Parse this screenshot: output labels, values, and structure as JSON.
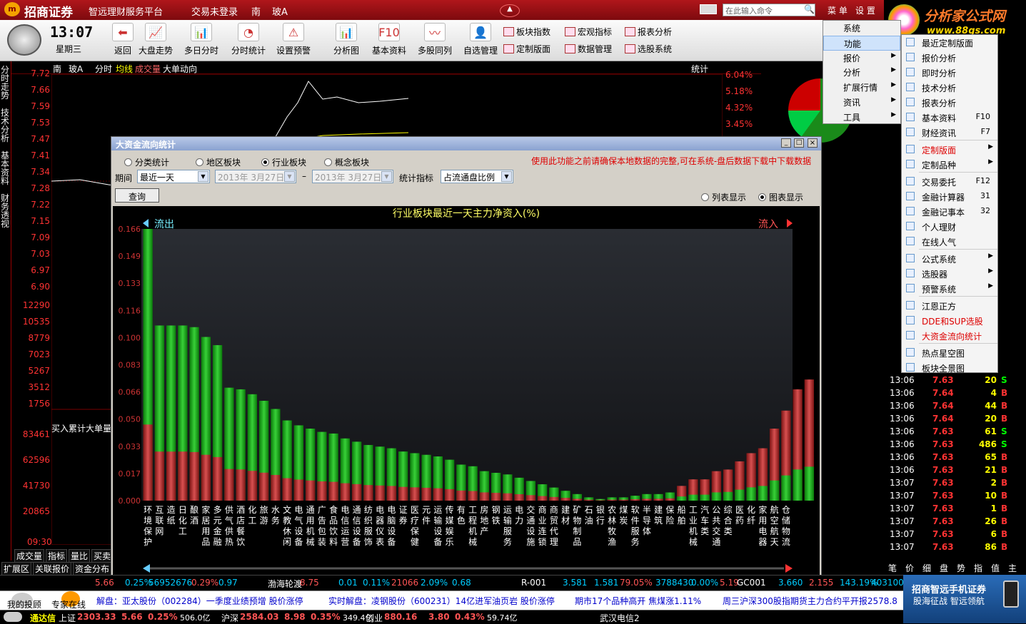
{
  "titlebar": {
    "brand": "招商证券",
    "platform": "智远理财服务平台",
    "status": "交易未登录",
    "region": "南",
    "stock": "玻A",
    "menu_btn": "菜 单",
    "settings_btn": "设 置",
    "search_placeholder": "在此输入命令"
  },
  "logo_right": {
    "name": "分析家公式网",
    "url": "www.88gs.com"
  },
  "clock": {
    "time": "13:07",
    "weekday": "星期三"
  },
  "toolbar": [
    {
      "label": "返回",
      "icon": "back-arrow-icon"
    },
    {
      "label": "大盘走势",
      "icon": "market-trend-icon"
    },
    {
      "label": "多日分时",
      "icon": "multi-day-icon"
    },
    {
      "label": "分时统计",
      "icon": "pie-stat-icon"
    },
    {
      "label": "设置预警",
      "icon": "warning-icon"
    },
    {
      "label": "分析图",
      "icon": "candlestick-icon"
    },
    {
      "label": "基本资料",
      "icon": "f10-icon"
    },
    {
      "label": "多股同列",
      "icon": "multi-stock-icon"
    },
    {
      "label": "自选管理",
      "icon": "watchlist-icon"
    }
  ],
  "toolbar_small": [
    "板块指数",
    "宏观指标",
    "报表分析",
    "定制版面",
    "数据管理",
    "选股系统"
  ],
  "left_tabs": [
    "分时走势",
    "技术分析",
    "基本资料",
    "财务透视"
  ],
  "chart_header": {
    "market": "南",
    "stock": "玻A",
    "labels": [
      "分时",
      "均线",
      "成交量",
      "大单动向"
    ],
    "stat": "统计"
  },
  "price_axis": [
    "7.72",
    "7.66",
    "7.59",
    "7.53",
    "7.47",
    "7.41",
    "7.34",
    "7.28",
    "7.22",
    "7.15",
    "7.09",
    "7.03",
    "6.97",
    "6.90"
  ],
  "pct_axis": [
    "6.04%",
    "5.18%",
    "4.32%",
    "3.45%"
  ],
  "vol_axis": [
    "12290",
    "10535",
    "8779",
    "7023",
    "5267",
    "3512",
    "1756"
  ],
  "vol2_axis": [
    "83461",
    "62596",
    "41730",
    "20865"
  ],
  "vol_label": "买入累计大单量",
  "time_label": "09:30",
  "bottom_tabs": [
    "成交量",
    "指标",
    "量比",
    "买卖",
    "扩展区",
    "关联报价",
    "资金分布"
  ],
  "menu1": {
    "items": [
      "系统",
      "功能",
      "报价",
      "分析",
      "扩展行情",
      "资讯",
      "工具"
    ],
    "selected": "功能"
  },
  "menu2": {
    "items": [
      {
        "label": "最近定制版面"
      },
      {
        "label": "报价分析"
      },
      {
        "label": "即时分析"
      },
      {
        "label": "技术分析"
      },
      {
        "label": "报表分析"
      },
      {
        "label": "基本资料",
        "key": "F10"
      },
      {
        "label": "财经资讯",
        "key": "F7"
      },
      {
        "sep": true
      },
      {
        "label": "定制版面",
        "sub": true,
        "red": true
      },
      {
        "label": "定制品种",
        "sub": true
      },
      {
        "sep": true
      },
      {
        "label": "交易委托",
        "key": "F12"
      },
      {
        "label": "金融计算器",
        "key": "31"
      },
      {
        "label": "金融记事本",
        "key": "32"
      },
      {
        "label": "个人理财"
      },
      {
        "label": "在线人气"
      },
      {
        "sep": true
      },
      {
        "label": "公式系统",
        "sub": true
      },
      {
        "label": "选股器",
        "sub": true
      },
      {
        "label": "预警系统",
        "sub": true
      },
      {
        "sep": true
      },
      {
        "label": "江恩正方"
      },
      {
        "label": "DDE和SUP选股",
        "red": true
      },
      {
        "label": "大资金流向统计",
        "red": true
      },
      {
        "sep": true
      },
      {
        "label": "热点星空图"
      },
      {
        "label": "板块全景图"
      }
    ]
  },
  "dialog": {
    "title": "大资金流向统计",
    "radios": [
      "分类统计",
      "地区板块",
      "行业板块",
      "概念板块"
    ],
    "selected_radio": "行业板块",
    "notice": "使用此功能之前请确保本地数据的完整,可在系统-盘后数据下载中下载数据",
    "period_label": "期间",
    "period": "最近一天",
    "date_from": "2013年 3月27日",
    "date_to": "2013年 3月27日",
    "stat_label": "统计指标",
    "stat_value": "占流通盘比例",
    "query_btn": "查询",
    "view_list": "列表显示",
    "view_chart": "图表显示"
  },
  "chart_data": {
    "type": "bar",
    "title": "行业板块最近一天主力净资入(%)",
    "outflow_label": "流出",
    "inflow_label": "流入",
    "y_ticks": [
      "0.166",
      "0.149",
      "0.133",
      "0.116",
      "0.100",
      "0.083",
      "0.066",
      "0.050",
      "0.033",
      "0.017",
      "0.000"
    ],
    "ylim": [
      0,
      0.166
    ],
    "categories": [
      "环境保护",
      "互联网",
      "造纸",
      "日化工",
      "酿酒",
      "家居用品",
      "多元金融",
      "供气供热",
      "酒店餐饮",
      "化工",
      "旅游",
      "水务",
      "文教休闲",
      "电气设备",
      "通用机械",
      "广告包装",
      "食品饮料",
      "电信运营",
      "通信设备",
      "纺织服饰",
      "电器仪表",
      "电脑设备",
      "证券",
      "医疗保健",
      "元件",
      "运输设备",
      "传媒娱乐",
      "有色",
      "工程机械",
      "房地产",
      "钢铁",
      "运输服务",
      "电力",
      "交通设施",
      "商业连锁",
      "商贸代理",
      "建材",
      "矿物制品",
      "石油",
      "银行",
      "农林牧渔",
      "煤炭",
      "软件服务",
      "半导体",
      "建筑",
      "保险",
      "船舶",
      "工业机械",
      "汽车类",
      "公共交通",
      "综合类",
      "医药",
      "化纤",
      "家用电器",
      "航空航天",
      "仓储物流"
    ],
    "series": [
      {
        "side": "out",
        "values": [
          0.166,
          0.107,
          0.107,
          0.107,
          0.106,
          0.1,
          0.095,
          0.069,
          0.068,
          0.065,
          0.061,
          0.056,
          0.049,
          0.046,
          0.044,
          0.042,
          0.041,
          0.038,
          0.036,
          0.034,
          0.033,
          0.032,
          0.03,
          0.029,
          0.028,
          0.027,
          0.025,
          0.022,
          0.021,
          0.018,
          0.017,
          0.016,
          0.014,
          0.012,
          0.01,
          0.008,
          0.006,
          0.004,
          0.002,
          0.001,
          0.002,
          0.002,
          0.003,
          0.004,
          0.004,
          0.005
        ]
      },
      {
        "side": "in",
        "values": [
          0.009,
          0.013,
          0.013,
          0.018,
          0.019,
          0.024,
          0.029,
          0.032,
          0.044,
          0.055,
          0.068,
          0.074
        ]
      }
    ]
  },
  "ticker": {
    "row1": [
      "5.66",
      "0.25%",
      "56952676",
      "0.29%",
      "0.97",
      "渤海轮渡",
      "8.75",
      "0.01",
      "0.11%",
      "21066",
      "2.09%",
      "0.68",
      "R-001",
      "3.581",
      "1.581",
      "79.05%",
      "3788430",
      "0.00%",
      "5.19",
      "GC001",
      "3.660",
      "2.155",
      "143.19%",
      "4031000"
    ],
    "news": [
      "解盘：亚太股份（002284）一季度业绩预增 股价涨停",
      "实时解盘：凌钢股份（600231）14亿进军油页岩 股价涨停",
      "期市17个品种高开 焦煤涨1.11%",
      "周三沪深300股指期货主力合约平开报2578.8点"
    ],
    "indices": [
      {
        "name": "上证",
        "val": "2303.33",
        "chg": "5.66",
        "pct": "0.25%",
        "amt": "506.0亿"
      },
      {
        "name": "沪深",
        "val": "2584.03",
        "chg": "8.98",
        "pct": "0.35%",
        "amt": "349.4亿"
      },
      {
        "name": "创业",
        "val": "880.16",
        "chg": "3.80",
        "pct": "0.43%",
        "amt": "59.74亿"
      }
    ],
    "app": "通达信",
    "server": "武汉电信2",
    "my_advisor": "我的投顾",
    "expert": "专家在线",
    "ad1": "招商智远手机证券",
    "ad2": "股海征战 智远领航"
  },
  "right_trades": [
    {
      "t": "13:06",
      "p": "7.63",
      "v": "20",
      "d": "S"
    },
    {
      "t": "13:06",
      "p": "7.64",
      "v": "4",
      "d": "B"
    },
    {
      "t": "13:06",
      "p": "7.64",
      "v": "44",
      "d": "B"
    },
    {
      "t": "13:06",
      "p": "7.64",
      "v": "20",
      "d": "B"
    },
    {
      "t": "13:06",
      "p": "7.63",
      "v": "61",
      "d": "S"
    },
    {
      "t": "13:06",
      "p": "7.63",
      "v": "486",
      "d": "S"
    },
    {
      "t": "13:06",
      "p": "7.63",
      "v": "65",
      "d": "B"
    },
    {
      "t": "13:06",
      "p": "7.63",
      "v": "21",
      "d": "B"
    },
    {
      "t": "13:07",
      "p": "7.63",
      "v": "2",
      "d": "B"
    },
    {
      "t": "13:07",
      "p": "7.63",
      "v": "10",
      "d": "B"
    },
    {
      "t": "13:07",
      "p": "7.63",
      "v": "1",
      "d": "B"
    },
    {
      "t": "13:07",
      "p": "7.63",
      "v": "26",
      "d": "B"
    },
    {
      "t": "13:07",
      "p": "7.63",
      "v": "6",
      "d": "B"
    },
    {
      "t": "13:07",
      "p": "7.63",
      "v": "86",
      "d": "B"
    }
  ],
  "right_tabs": [
    "龙虎",
    "风向",
    "笔",
    "价",
    "细",
    "盘",
    "势",
    "指",
    "值",
    "主"
  ]
}
